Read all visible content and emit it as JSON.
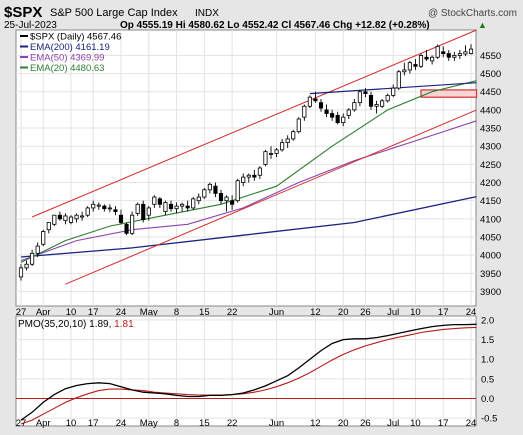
{
  "header": {
    "symbol": "$SPX",
    "name": "S&P 500 Large Cap Index",
    "exchange": "INDX",
    "watermark": "@ StockCharts.com",
    "date": "25-Jul-2023",
    "ohlc": "Op 4555.19  Hi 4580.62  Lo 4552.42  Cl 4567.46  Chg +12.82 (+0.28%)",
    "chg_arrow": "▲"
  },
  "legend": [
    {
      "label": "$SPX (Daily) 4567.46",
      "color": "#000000"
    },
    {
      "label": "EMA(200) 4161.19",
      "color": "#1a237e"
    },
    {
      "label": "EMA(50) 4369.99",
      "color": "#8e44ad"
    },
    {
      "label": "EMA(20) 4480.63",
      "color": "#2e7d32"
    }
  ],
  "pmo_label": {
    "text": "PMO(35,20,10) 1.89, ",
    "signal": "1.81",
    "signal_color": "#b71c1c"
  },
  "chart_data": [
    {
      "type": "candlestick",
      "series_name": "$SPX (Daily)",
      "ylim": [
        3860,
        4620
      ],
      "y_ticks": [
        3900,
        3950,
        4000,
        4050,
        4100,
        4150,
        4200,
        4250,
        4300,
        4350,
        4400,
        4450,
        4500,
        4550
      ],
      "x_ticks": [
        {
          "label": "27",
          "i": 0
        },
        {
          "label": "Apr",
          "i": 4
        },
        {
          "label": "10",
          "i": 9
        },
        {
          "label": "17",
          "i": 13
        },
        {
          "label": "24",
          "i": 18
        },
        {
          "label": "May",
          "i": 23
        },
        {
          "label": "8",
          "i": 28
        },
        {
          "label": "15",
          "i": 33
        },
        {
          "label": "22",
          "i": 38
        },
        {
          "label": "Jun",
          "i": 46
        },
        {
          "label": "12",
          "i": 53
        },
        {
          "label": "20",
          "i": 58
        },
        {
          "label": "26",
          "i": 62
        },
        {
          "label": "Jul",
          "i": 67
        },
        {
          "label": "10",
          "i": 71
        },
        {
          "label": "17",
          "i": 76
        },
        {
          "label": "24",
          "i": 81
        }
      ],
      "candles": [
        [
          3940,
          3975,
          3930,
          3965
        ],
        [
          3965,
          3985,
          3958,
          3975
        ],
        [
          3975,
          4015,
          3970,
          4005
        ],
        [
          4005,
          4035,
          3995,
          4025
        ],
        [
          4030,
          4070,
          4025,
          4065
        ],
        [
          4070,
          4090,
          4060,
          4090
        ],
        [
          4085,
          4095,
          4080,
          4110
        ],
        [
          4110,
          4120,
          4095,
          4100
        ],
        [
          4095,
          4115,
          4085,
          4108
        ],
        [
          4090,
          4110,
          4085,
          4105
        ],
        [
          4100,
          4115,
          4090,
          4110
        ],
        [
          4105,
          4120,
          4095,
          4108
        ],
        [
          4110,
          4135,
          4105,
          4130
        ],
        [
          4130,
          4150,
          4120,
          4140
        ],
        [
          4135,
          4145,
          4125,
          4138
        ],
        [
          4135,
          4140,
          4120,
          4128
        ],
        [
          4130,
          4140,
          4118,
          4130
        ],
        [
          4125,
          4135,
          4110,
          4120
        ],
        [
          4110,
          4125,
          4085,
          4090
        ],
        [
          4085,
          4090,
          4055,
          4060
        ],
        [
          4060,
          4120,
          4055,
          4110
        ],
        [
          4115,
          4145,
          4108,
          4140
        ],
        [
          4140,
          4150,
          4090,
          4098
        ],
        [
          4110,
          4135,
          4095,
          4130
        ],
        [
          4140,
          4165,
          4130,
          4160
        ],
        [
          4155,
          4160,
          4130,
          4140
        ],
        [
          4120,
          4150,
          4110,
          4145
        ],
        [
          4140,
          4150,
          4120,
          4128
        ],
        [
          4128,
          4145,
          4115,
          4135
        ],
        [
          4135,
          4145,
          4120,
          4140
        ],
        [
          4135,
          4150,
          4120,
          4130
        ],
        [
          4130,
          4160,
          4125,
          4155
        ],
        [
          4150,
          4170,
          4140,
          4160
        ],
        [
          4160,
          4185,
          4155,
          4180
        ],
        [
          4180,
          4200,
          4170,
          4195
        ],
        [
          4190,
          4200,
          4160,
          4170
        ],
        [
          4170,
          4180,
          4140,
          4150
        ],
        [
          4150,
          4165,
          4120,
          4160
        ],
        [
          4150,
          4165,
          4125,
          4140
        ],
        [
          4150,
          4210,
          4145,
          4205
        ],
        [
          4200,
          4225,
          4190,
          4215
        ],
        [
          4215,
          4225,
          4200,
          4220
        ],
        [
          4220,
          4235,
          4205,
          4215
        ],
        [
          4220,
          4245,
          4210,
          4240
        ],
        [
          4250,
          4290,
          4245,
          4285
        ],
        [
          4280,
          4300,
          4265,
          4280
        ],
        [
          4280,
          4295,
          4270,
          4290
        ],
        [
          4290,
          4320,
          4285,
          4310
        ],
        [
          4310,
          4330,
          4295,
          4320
        ],
        [
          4320,
          4345,
          4315,
          4340
        ],
        [
          4340,
          4380,
          4335,
          4375
        ],
        [
          4380,
          4415,
          4370,
          4410
        ],
        [
          4410,
          4440,
          4405,
          4435
        ],
        [
          4430,
          4450,
          4420,
          4425
        ],
        [
          4420,
          4430,
          4395,
          4405
        ],
        [
          4400,
          4415,
          4380,
          4390
        ],
        [
          4390,
          4400,
          4370,
          4380
        ],
        [
          4385,
          4395,
          4360,
          4365
        ],
        [
          4365,
          4390,
          4355,
          4380
        ],
        [
          4385,
          4405,
          4375,
          4400
        ],
        [
          4400,
          4430,
          4395,
          4420
        ],
        [
          4420,
          4455,
          4410,
          4450
        ],
        [
          4450,
          4460,
          4435,
          4445
        ],
        [
          4440,
          4450,
          4400,
          4410
        ],
        [
          4410,
          4425,
          4390,
          4415
        ],
        [
          4410,
          4430,
          4405,
          4425
        ],
        [
          4425,
          4445,
          4420,
          4440
        ],
        [
          4440,
          4470,
          4435,
          4460
        ],
        [
          4460,
          4510,
          4455,
          4505
        ],
        [
          4505,
          4530,
          4495,
          4510
        ],
        [
          4510,
          4535,
          4500,
          4530
        ],
        [
          4525,
          4540,
          4510,
          4520
        ],
        [
          4520,
          4555,
          4515,
          4550
        ],
        [
          4545,
          4565,
          4535,
          4540
        ],
        [
          4535,
          4550,
          4525,
          4545
        ],
        [
          4545,
          4580,
          4540,
          4575
        ],
        [
          4560,
          4575,
          4545,
          4555
        ],
        [
          4555,
          4565,
          4535,
          4545
        ],
        [
          4545,
          4560,
          4535,
          4550
        ],
        [
          4550,
          4565,
          4540,
          4555
        ],
        [
          4554,
          4578,
          4548,
          4560
        ],
        [
          4555.19,
          4580.62,
          4552.42,
          4567.46
        ]
      ],
      "ema200": [
        [
          0,
          3995
        ],
        [
          20,
          4020
        ],
        [
          40,
          4055
        ],
        [
          60,
          4090
        ],
        [
          82,
          4161.19
        ]
      ],
      "ema50": [
        [
          0,
          3985
        ],
        [
          10,
          4040
        ],
        [
          20,
          4070
        ],
        [
          30,
          4085
        ],
        [
          40,
          4130
        ],
        [
          50,
          4200
        ],
        [
          60,
          4260
        ],
        [
          70,
          4310
        ],
        [
          82,
          4369.99
        ]
      ],
      "ema20": [
        [
          0,
          3980
        ],
        [
          8,
          4040
        ],
        [
          16,
          4080
        ],
        [
          26,
          4110
        ],
        [
          36,
          4140
        ],
        [
          46,
          4190
        ],
        [
          56,
          4300
        ],
        [
          66,
          4400
        ],
        [
          74,
          4450
        ],
        [
          82,
          4480.63
        ]
      ],
      "channel_upper": [
        [
          2,
          4105
        ],
        [
          82,
          4620
        ]
      ],
      "channel_lower": [
        [
          8,
          3920
        ],
        [
          82,
          4400
        ]
      ],
      "blue_line": [
        [
          52,
          4445
        ],
        [
          82,
          4475
        ]
      ],
      "resistance_box": {
        "i_start": 72,
        "i_end": 82,
        "y_low": 4435,
        "y_high": 4455
      }
    },
    {
      "type": "line",
      "indicator": "PMO(35,20,10)",
      "ylim": [
        -0.7,
        2.1
      ],
      "y_ticks": [
        -0.5,
        0.0,
        0.5,
        1.0,
        1.5,
        2.0
      ],
      "zero_line_color": "#b71c1c",
      "pmo": [
        [
          0,
          -0.55
        ],
        [
          2,
          -0.35
        ],
        [
          4,
          -0.1
        ],
        [
          6,
          0.1
        ],
        [
          8,
          0.25
        ],
        [
          10,
          0.33
        ],
        [
          12,
          0.38
        ],
        [
          14,
          0.4
        ],
        [
          16,
          0.38
        ],
        [
          18,
          0.3
        ],
        [
          20,
          0.22
        ],
        [
          22,
          0.16
        ],
        [
          24,
          0.14
        ],
        [
          26,
          0.12
        ],
        [
          28,
          0.08
        ],
        [
          30,
          0.05
        ],
        [
          32,
          0.05
        ],
        [
          34,
          0.08
        ],
        [
          36,
          0.08
        ],
        [
          38,
          0.1
        ],
        [
          40,
          0.14
        ],
        [
          42,
          0.22
        ],
        [
          44,
          0.32
        ],
        [
          46,
          0.45
        ],
        [
          48,
          0.58
        ],
        [
          50,
          0.78
        ],
        [
          52,
          1.0
        ],
        [
          54,
          1.22
        ],
        [
          56,
          1.4
        ],
        [
          58,
          1.5
        ],
        [
          60,
          1.52
        ],
        [
          62,
          1.52
        ],
        [
          64,
          1.55
        ],
        [
          66,
          1.6
        ],
        [
          68,
          1.66
        ],
        [
          70,
          1.72
        ],
        [
          72,
          1.78
        ],
        [
          74,
          1.83
        ],
        [
          76,
          1.86
        ],
        [
          78,
          1.88
        ],
        [
          80,
          1.88
        ],
        [
          82,
          1.89
        ]
      ],
      "signal": [
        [
          0,
          -0.65
        ],
        [
          2,
          -0.55
        ],
        [
          4,
          -0.4
        ],
        [
          6,
          -0.25
        ],
        [
          8,
          -0.1
        ],
        [
          10,
          0.02
        ],
        [
          12,
          0.12
        ],
        [
          14,
          0.2
        ],
        [
          16,
          0.24
        ],
        [
          18,
          0.24
        ],
        [
          20,
          0.22
        ],
        [
          22,
          0.2
        ],
        [
          24,
          0.16
        ],
        [
          26,
          0.14
        ],
        [
          28,
          0.12
        ],
        [
          30,
          0.1
        ],
        [
          32,
          0.09
        ],
        [
          34,
          0.09
        ],
        [
          36,
          0.09
        ],
        [
          38,
          0.1
        ],
        [
          40,
          0.12
        ],
        [
          42,
          0.16
        ],
        [
          44,
          0.22
        ],
        [
          46,
          0.3
        ],
        [
          48,
          0.4
        ],
        [
          50,
          0.52
        ],
        [
          52,
          0.66
        ],
        [
          54,
          0.82
        ],
        [
          56,
          0.98
        ],
        [
          58,
          1.12
        ],
        [
          60,
          1.24
        ],
        [
          62,
          1.34
        ],
        [
          64,
          1.42
        ],
        [
          66,
          1.5
        ],
        [
          68,
          1.56
        ],
        [
          70,
          1.62
        ],
        [
          72,
          1.68
        ],
        [
          74,
          1.72
        ],
        [
          76,
          1.76
        ],
        [
          78,
          1.78
        ],
        [
          80,
          1.8
        ],
        [
          82,
          1.81
        ]
      ]
    }
  ]
}
